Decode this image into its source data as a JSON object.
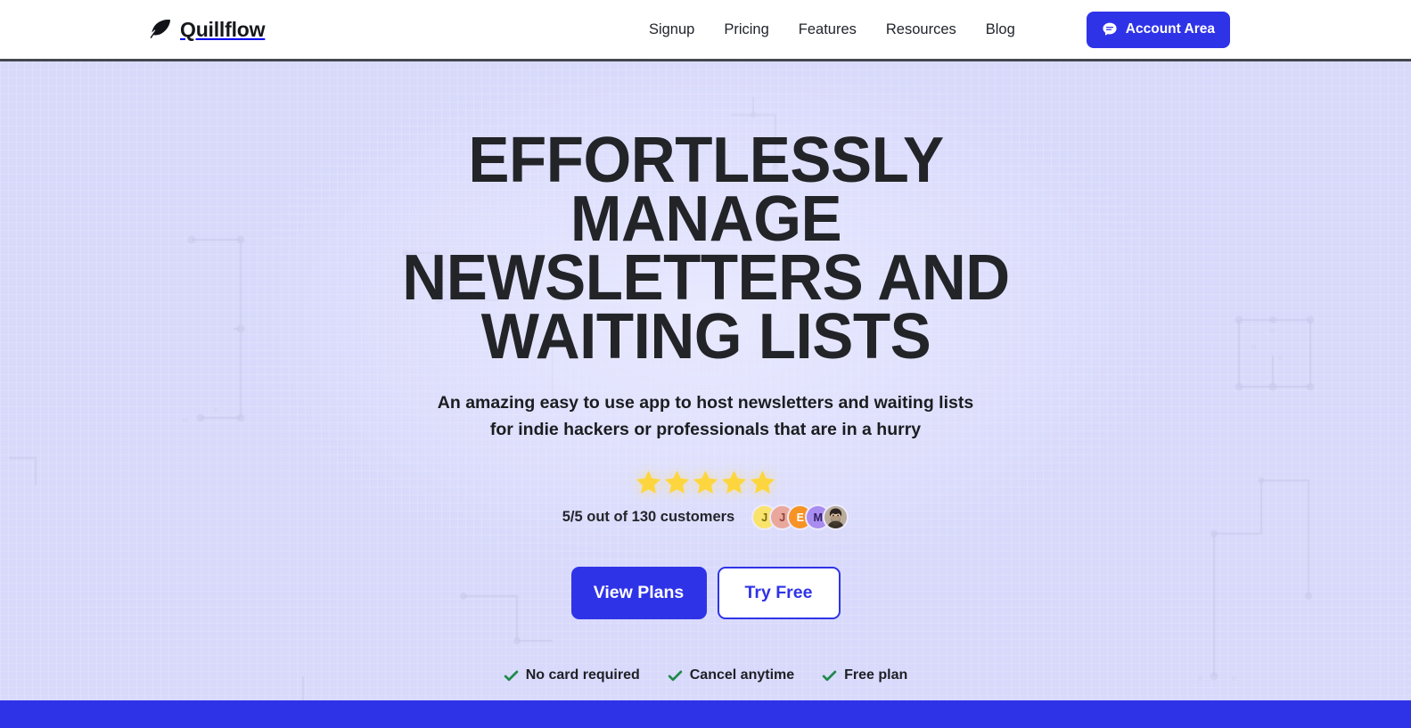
{
  "header": {
    "brand": {
      "name": "Quillflow",
      "icon": "feather-icon"
    },
    "nav_links": [
      {
        "label": "Signup"
      },
      {
        "label": "Pricing"
      },
      {
        "label": "Features"
      },
      {
        "label": "Resources"
      },
      {
        "label": "Blog"
      }
    ],
    "account_button": {
      "label": "Account Area",
      "icon": "chat-bubble-icon"
    }
  },
  "hero": {
    "title": "EFFORTLESSLY MANAGE NEWSLETTERS AND WAITING LISTS",
    "title_lines": [
      "EFFORTLESSLY MANAGE",
      "NEWSLETTERS AND",
      "WAITING LISTS"
    ],
    "subtitle_lines": [
      "An amazing easy to use app to host newsletters and waiting lists",
      "for indie hackers or professionals that are in a hurry"
    ],
    "rating": {
      "stars_filled": 5,
      "stars_total": 5,
      "text": "5/5 out of 130 customers",
      "avatars": [
        {
          "initial": "J",
          "color": "#fae36b"
        },
        {
          "initial": "J",
          "color": "#eaa89d"
        },
        {
          "initial": "E",
          "color": "#f79325"
        },
        {
          "initial": "M",
          "color": "#a98cf0"
        },
        {
          "initial": "",
          "color": "#6b5a4a",
          "type": "photo"
        }
      ]
    },
    "cta": {
      "primary": {
        "label": "View Plans"
      },
      "secondary": {
        "label": "Try Free"
      }
    },
    "perks": [
      {
        "label": "No card required",
        "icon": "check-icon"
      },
      {
        "label": "Cancel anytime",
        "icon": "check-icon"
      },
      {
        "label": "Free plan",
        "icon": "check-icon"
      }
    ]
  },
  "colors": {
    "brand_blue": "#2f33e8",
    "hero_background": "#d8d9fb",
    "star_yellow": "#fdd63f",
    "check_green": "#1f8a4c",
    "text_dark": "#1d2025",
    "header_background": "#ffffff",
    "header_border": "#44474f"
  }
}
